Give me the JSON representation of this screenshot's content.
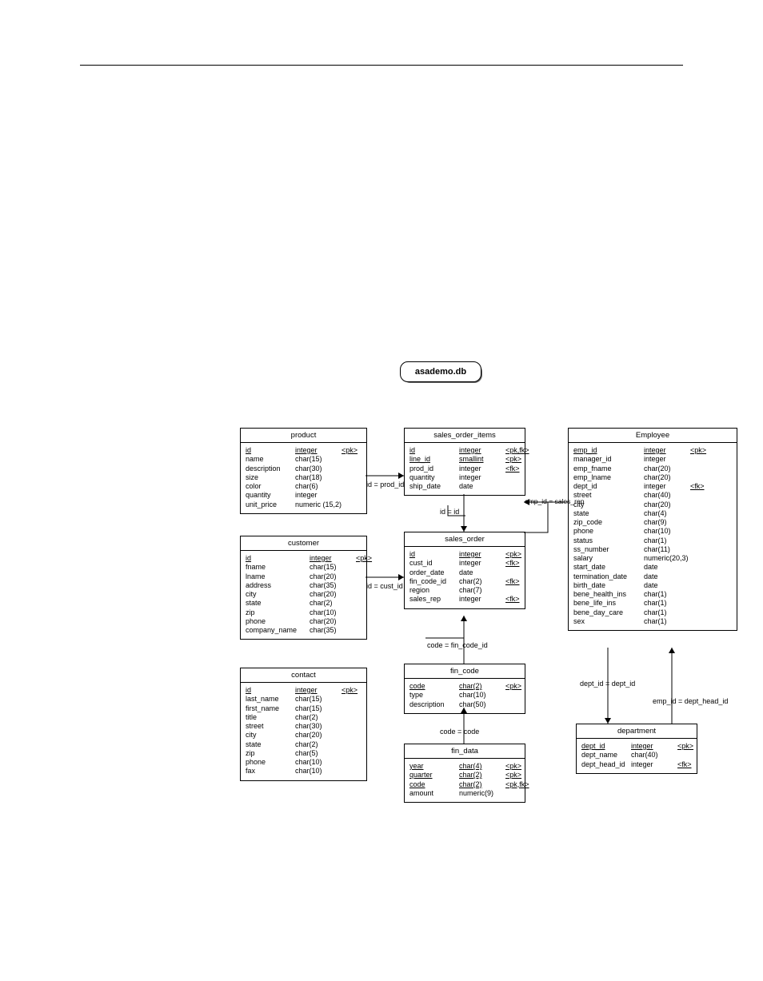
{
  "db_name": "asademo.db",
  "entities": {
    "product": {
      "title": "product",
      "columns": [
        {
          "name": "id",
          "type": "integer",
          "key": "<pk>",
          "pk": true
        },
        {
          "name": "name",
          "type": "char(15)",
          "key": ""
        },
        {
          "name": "description",
          "type": "char(30)",
          "key": ""
        },
        {
          "name": "size",
          "type": "char(18)",
          "key": ""
        },
        {
          "name": "color",
          "type": "char(6)",
          "key": ""
        },
        {
          "name": "quantity",
          "type": "integer",
          "key": ""
        },
        {
          "name": "unit_price",
          "type": "numeric (15,2)",
          "key": ""
        }
      ]
    },
    "customer": {
      "title": "customer",
      "columns": [
        {
          "name": "id",
          "type": "integer",
          "key": "<pk>",
          "pk": true
        },
        {
          "name": "fname",
          "type": "char(15)",
          "key": ""
        },
        {
          "name": "lname",
          "type": "char(20)",
          "key": ""
        },
        {
          "name": "address",
          "type": "char(35)",
          "key": ""
        },
        {
          "name": "city",
          "type": "char(20)",
          "key": ""
        },
        {
          "name": "state",
          "type": "char(2)",
          "key": ""
        },
        {
          "name": "zip",
          "type": "char(10)",
          "key": ""
        },
        {
          "name": "phone",
          "type": "char(20)",
          "key": ""
        },
        {
          "name": "company_name",
          "type": "char(35)",
          "key": ""
        }
      ]
    },
    "contact": {
      "title": "contact",
      "columns": [
        {
          "name": "id",
          "type": "integer",
          "key": "<pk>",
          "pk": true
        },
        {
          "name": "last_name",
          "type": "char(15)",
          "key": ""
        },
        {
          "name": "first_name",
          "type": "char(15)",
          "key": ""
        },
        {
          "name": "title",
          "type": "char(2)",
          "key": ""
        },
        {
          "name": "street",
          "type": "char(30)",
          "key": ""
        },
        {
          "name": "city",
          "type": "char(20)",
          "key": ""
        },
        {
          "name": "state",
          "type": "char(2)",
          "key": ""
        },
        {
          "name": "zip",
          "type": "char(5)",
          "key": ""
        },
        {
          "name": "phone",
          "type": "char(10)",
          "key": ""
        },
        {
          "name": "fax",
          "type": "char(10)",
          "key": ""
        }
      ]
    },
    "sales_order_items": {
      "title": "sales_order_items",
      "columns": [
        {
          "name": "id",
          "type": "integer",
          "key": "<pk,fk>",
          "pk": true
        },
        {
          "name": "line_id",
          "type": "smallint",
          "key": "<pk>",
          "pk": true
        },
        {
          "name": "prod_id",
          "type": "integer",
          "key": "<fk>"
        },
        {
          "name": "quantity",
          "type": "integer",
          "key": ""
        },
        {
          "name": "ship_date",
          "type": "date",
          "key": ""
        }
      ]
    },
    "sales_order": {
      "title": "sales_order",
      "columns": [
        {
          "name": "id",
          "type": "integer",
          "key": "<pk>",
          "pk": true
        },
        {
          "name": "cust_id",
          "type": "integer",
          "key": "<fk>"
        },
        {
          "name": "order_date",
          "type": "date",
          "key": ""
        },
        {
          "name": "fin_code_id",
          "type": "char(2)",
          "key": "<fk>"
        },
        {
          "name": "region",
          "type": "char(7)",
          "key": ""
        },
        {
          "name": "sales_rep",
          "type": "integer",
          "key": "<fk>"
        }
      ]
    },
    "fin_code": {
      "title": "fin_code",
      "columns": [
        {
          "name": "code",
          "type": "char(2)",
          "key": "<pk>",
          "pk": true
        },
        {
          "name": "type",
          "type": "char(10)",
          "key": ""
        },
        {
          "name": "description",
          "type": "char(50)",
          "key": ""
        }
      ]
    },
    "fin_data": {
      "title": "fin_data",
      "columns": [
        {
          "name": "year",
          "type": "char(4)",
          "key": "<pk>",
          "pk": true
        },
        {
          "name": "quarter",
          "type": "char(2)",
          "key": "<pk>",
          "pk": true
        },
        {
          "name": "code",
          "type": "char(2)",
          "key": "<pk,fk>",
          "pk": true
        },
        {
          "name": "amount",
          "type": "numeric(9)",
          "key": ""
        }
      ]
    },
    "employee": {
      "title": "Employee",
      "columns": [
        {
          "name": "emp_id",
          "type": "integer",
          "key": "<pk>",
          "pk": true
        },
        {
          "name": "manager_id",
          "type": "integer",
          "key": ""
        },
        {
          "name": "emp_fname",
          "type": "char(20)",
          "key": ""
        },
        {
          "name": "emp_lname",
          "type": "char(20)",
          "key": ""
        },
        {
          "name": "dept_id",
          "type": "integer",
          "key": "<fk>"
        },
        {
          "name": "street",
          "type": "char(40)",
          "key": ""
        },
        {
          "name": "city",
          "type": "char(20)",
          "key": ""
        },
        {
          "name": "state",
          "type": "char(4)",
          "key": ""
        },
        {
          "name": "zip_code",
          "type": "char(9)",
          "key": ""
        },
        {
          "name": "phone",
          "type": "char(10)",
          "key": ""
        },
        {
          "name": "status",
          "type": "char(1)",
          "key": ""
        },
        {
          "name": "ss_number",
          "type": "char(11)",
          "key": ""
        },
        {
          "name": "salary",
          "type": "numeric(20,3)",
          "key": ""
        },
        {
          "name": "start_date",
          "type": "date",
          "key": ""
        },
        {
          "name": "termination_date",
          "type": "date",
          "key": ""
        },
        {
          "name": "birth_date",
          "type": "date",
          "key": ""
        },
        {
          "name": "bene_health_ins",
          "type": "char(1)",
          "key": ""
        },
        {
          "name": "bene_life_ins",
          "type": "char(1)",
          "key": ""
        },
        {
          "name": "bene_day_care",
          "type": "char(1)",
          "key": ""
        },
        {
          "name": "sex",
          "type": "char(1)",
          "key": ""
        }
      ]
    },
    "department": {
      "title": "department",
      "columns": [
        {
          "name": "dept_id",
          "type": "integer",
          "key": "<pk>",
          "pk": true
        },
        {
          "name": "dept_name",
          "type": "char(40)",
          "key": ""
        },
        {
          "name": "dept_head_id",
          "type": "integer",
          "key": "<fk>"
        }
      ]
    }
  },
  "relations": {
    "r1": "id = prod_id",
    "r2": "id = id",
    "r3": "id = cust_id",
    "r4": "code = fin_code_id",
    "r5": "code = code",
    "r6": "emp_id = sales_rep",
    "r7": "dept_id = dept_id",
    "r8": "emp_id = dept_head_id"
  }
}
